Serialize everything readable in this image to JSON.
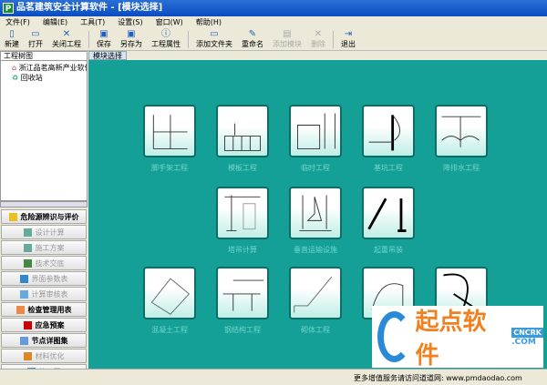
{
  "window": {
    "title": "品茗建筑安全计算软件 - [模块选择]"
  },
  "menu": [
    "文件(F)",
    "编辑(E)",
    "工具(T)",
    "设置(S)",
    "窗口(W)",
    "帮助(H)"
  ],
  "toolbar": [
    {
      "label": "新建",
      "icon": "new-file-icon",
      "enabled": true
    },
    {
      "label": "打开",
      "icon": "open-folder-icon",
      "enabled": true
    },
    {
      "label": "关闭工程",
      "icon": "close-icon",
      "enabled": true
    },
    {
      "label": "保存",
      "icon": "save-icon",
      "enabled": true
    },
    {
      "label": "另存为",
      "icon": "save-as-icon",
      "enabled": true
    },
    {
      "label": "工程属性",
      "icon": "info-icon",
      "enabled": true
    },
    {
      "label": "添加文件夹",
      "icon": "add-folder-icon",
      "enabled": true
    },
    {
      "label": "重命名",
      "icon": "rename-icon",
      "enabled": true
    },
    {
      "label": "添加模块",
      "icon": "add-module-icon",
      "enabled": false
    },
    {
      "label": "删除",
      "icon": "delete-icon",
      "enabled": false
    },
    {
      "label": "退出",
      "icon": "exit-icon",
      "enabled": true
    }
  ],
  "tree": {
    "header": "工程树图",
    "items": [
      "浙江品茗高新产业软件",
      "回收站"
    ]
  },
  "left_buttons": [
    {
      "label": "危险源辨识与评价",
      "active": true,
      "color": "#e8c020"
    },
    {
      "label": "设计计算",
      "active": false,
      "color": "#6a9"
    },
    {
      "label": "施工方案",
      "active": false,
      "color": "#6a9"
    },
    {
      "label": "技术交底",
      "active": false,
      "color": "#484"
    },
    {
      "label": "界面参数表",
      "active": false,
      "color": "#38c"
    },
    {
      "label": "计算审核表",
      "active": false,
      "color": "#6ad"
    },
    {
      "label": "检查管理用表",
      "active": true,
      "color": "#e84"
    },
    {
      "label": "应急预案",
      "active": true,
      "color": "#c00"
    },
    {
      "label": "节点详图集",
      "active": true,
      "color": "#69d"
    },
    {
      "label": "材料优化",
      "active": false,
      "color": "#d82"
    },
    {
      "label": "施工图",
      "active": false,
      "color": "#59c"
    }
  ],
  "tab": "模块选择",
  "modules": [
    "脚手架工程",
    "模板工程",
    "临时工程",
    "基坑工程",
    "降排水工程",
    "塔吊计算",
    "垂直运输设施",
    "起重吊装",
    "混凝土工程",
    "钢结构工程",
    "砌体工程",
    "",
    ""
  ],
  "status": "更多增值服务请访问道道网: www.pmdaodao.com",
  "watermark": {
    "text": "起点软件",
    "badge": "CNCRK",
    ".com": ".COM"
  }
}
